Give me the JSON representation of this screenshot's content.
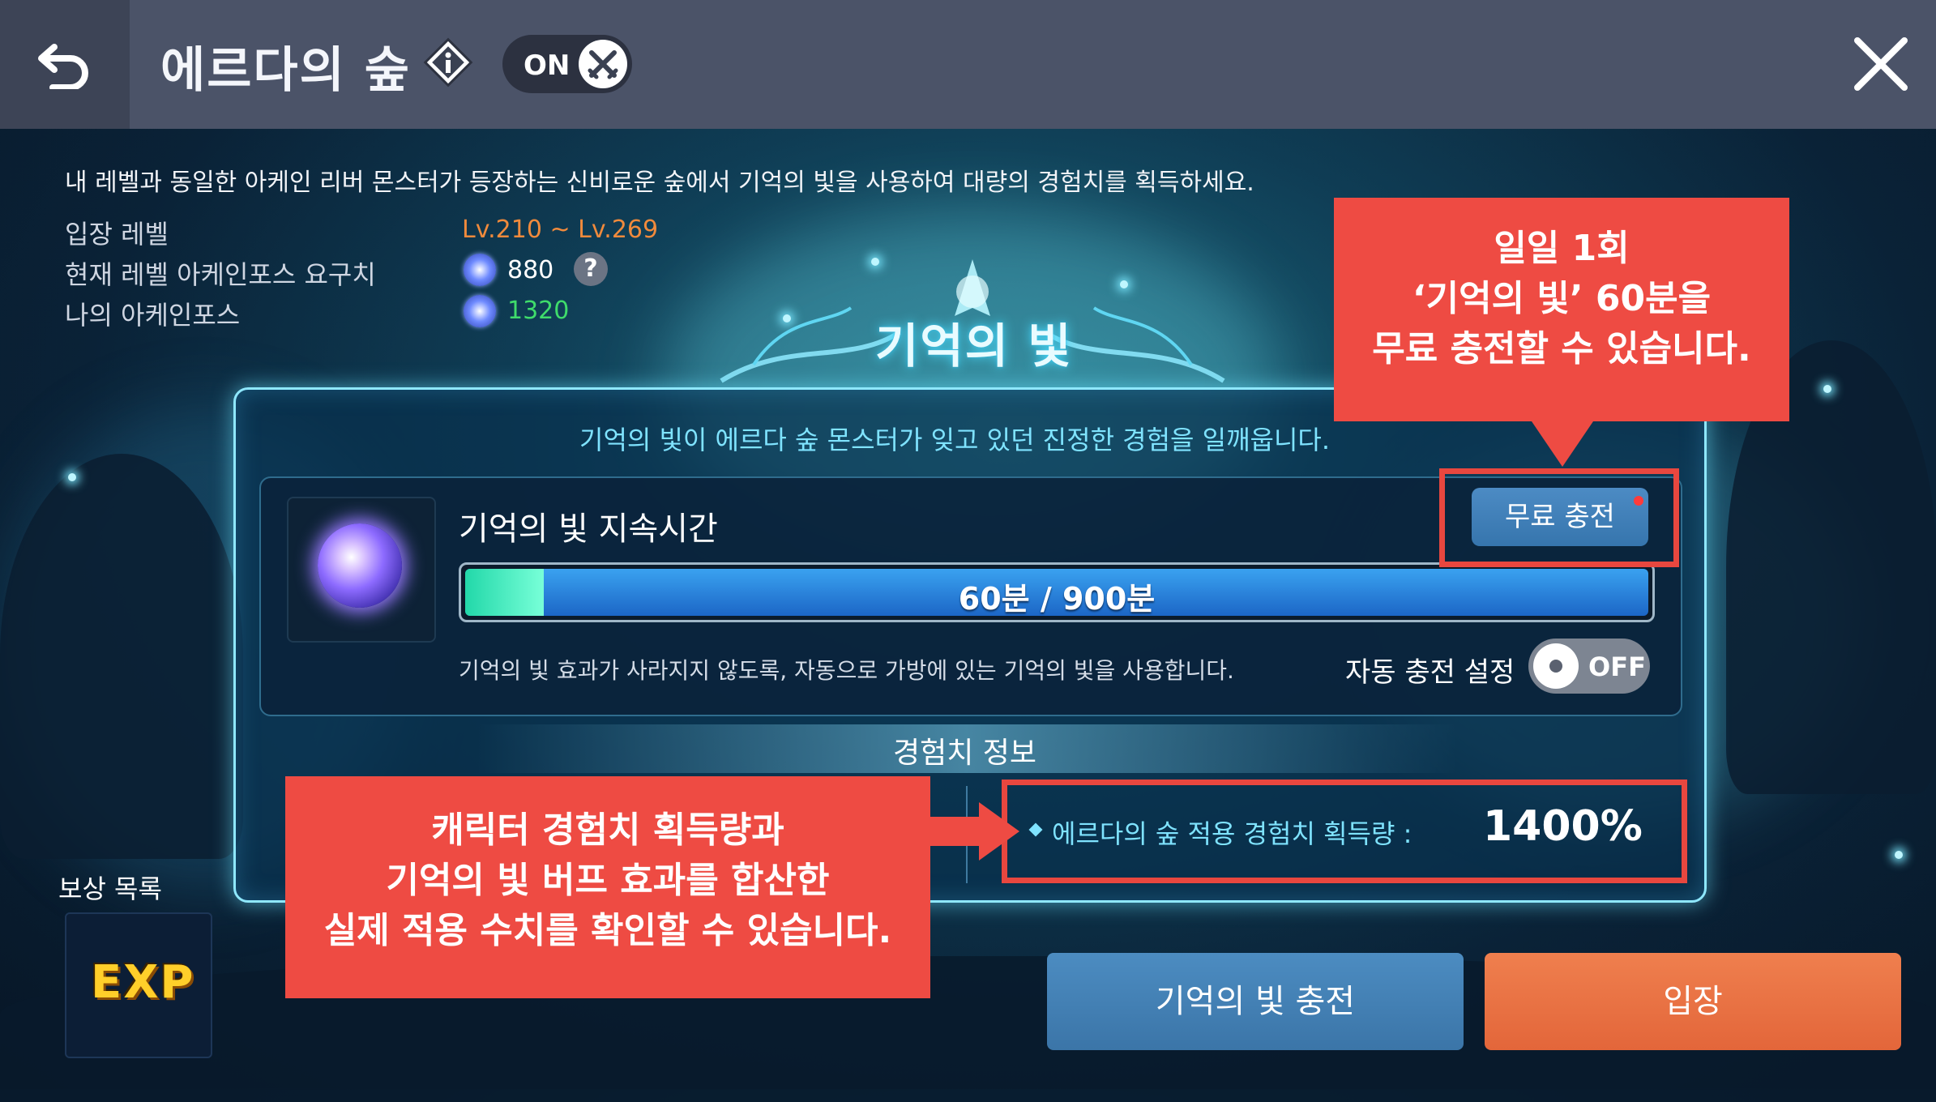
{
  "header": {
    "title": "에르다의 숲",
    "toggle_label": "ON"
  },
  "intro": {
    "description": "내 레벨과 동일한 아케인 리버 몬스터가 등장하는 신비로운 숲에서 기억의 빛을 사용하여 대량의 경험치를 획득하세요.",
    "rows": [
      {
        "label": "입장 레벨",
        "value": "Lv.210 ~ Lv.269",
        "color": "#f08a3c"
      },
      {
        "label": "현재 레벨 아케인포스 요구치",
        "value": "880",
        "color": "#ffffff"
      },
      {
        "label": "나의 아케인포스",
        "value": "1320",
        "color": "#3fdc6b"
      }
    ],
    "help_glyph": "?"
  },
  "panel": {
    "crest_title": "기억의 빛",
    "subtitle": "기억의 빛이 에르다 숲 몬스터가 잊고 있던 진정한 경험을 일깨웁니다.",
    "duration": {
      "title": "기억의 빛 지속시간",
      "current_minutes": 60,
      "max_minutes": 900,
      "progress": 0.0667,
      "bar_text": "60분 / 900분"
    },
    "free_charge_label": "무료 충전",
    "auto": {
      "description": "기억의 빛 효과가 사라지지 않도록, 자동으로 가방에 있는 기억의 빛을 사용합니다.",
      "label": "자동 충전 설정",
      "toggle_label": "OFF"
    },
    "exp_info": {
      "title": "경험치 정보",
      "label": "에르다의 숲 적용 경험치 획득량 :",
      "value": "1400%"
    }
  },
  "callouts": {
    "top": [
      "일일 1회",
      "‘기억의 빛’ 60분을",
      "무료 충전할 수 있습니다."
    ],
    "bottom": [
      "캐릭터 경험치 획득량과",
      "기억의 빛 버프 효과를 합산한",
      "실제 적용 수치를 확인할 수 있습니다."
    ]
  },
  "rewards": {
    "label": "보상 목록",
    "badge": "EXP"
  },
  "buttons": {
    "charge": "기억의 빛 충전",
    "enter": "입장"
  },
  "colors": {
    "header_bg": "#4b5368",
    "accent_cyan": "#7fe3ff",
    "callout_red": "#ee4b43",
    "enter_orange": "#e86c3f",
    "charge_blue": "#3f7cb0"
  },
  "icons": [
    "back-arrow-icon",
    "info-diamond-icon",
    "crossed-swords-icon",
    "close-icon",
    "arcane-force-icon",
    "help-icon",
    "memory-light-orb-icon",
    "exp-badge-icon"
  ]
}
